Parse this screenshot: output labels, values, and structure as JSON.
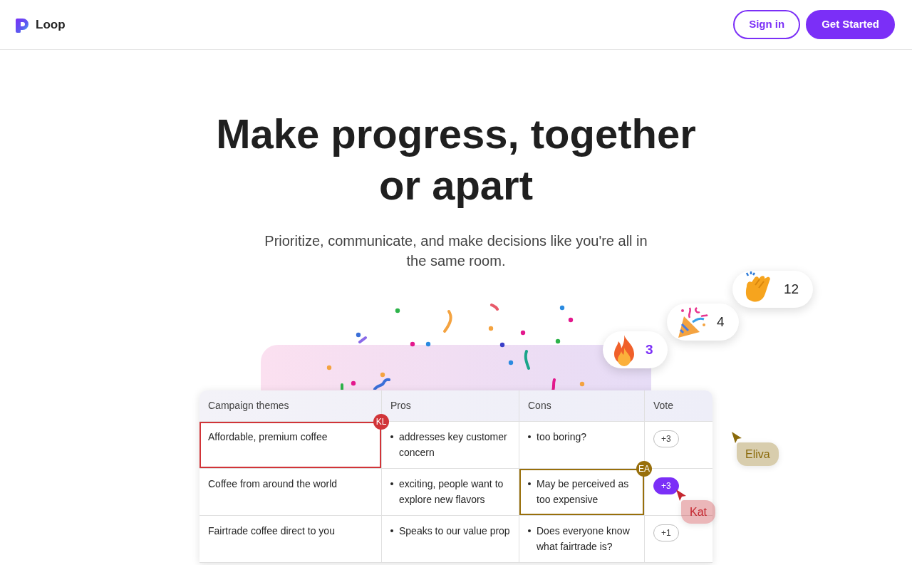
{
  "nav": {
    "brand": "Loop",
    "buttons": [
      {
        "label": "Sign in",
        "kind": "outline"
      },
      {
        "label": "Get Started",
        "kind": "primary"
      }
    ]
  },
  "hero": {
    "title_lines": [
      "Make progress, together",
      "or apart"
    ],
    "subtitle": "Prioritize, communicate, and make decisions like you're all in the same room."
  },
  "reactions": [
    {
      "kind": "fire",
      "count": "3",
      "selected": true
    },
    {
      "kind": "party",
      "count": "4",
      "selected": false
    },
    {
      "kind": "clap",
      "count": "12",
      "selected": false
    }
  ],
  "table": {
    "columns": [
      "Campaign themes",
      "Pros",
      "Cons",
      "Vote"
    ],
    "rows": [
      {
        "theme": {
          "text": "Affordable, premium coffee",
          "editor": {
            "initials": "KL",
            "color": "#d13438"
          }
        },
        "pros": {
          "items": [
            "addresses key customer concern"
          ]
        },
        "cons": {
          "items": [
            "too boring?"
          ]
        },
        "vote": {
          "label": "+3",
          "selected": false
        }
      },
      {
        "theme": {
          "text": "Coffee from around the world"
        },
        "pros": {
          "items": [
            "exciting, people want to explore new flavors"
          ]
        },
        "cons": {
          "items": [
            "May be perceived as too expensive"
          ],
          "editor": {
            "initials": "EA",
            "color": "#986f0b"
          }
        },
        "vote": {
          "label": "+3",
          "selected": true
        }
      },
      {
        "theme": {
          "text": "Fairtrade coffee direct to you"
        },
        "pros": {
          "items": [
            "Speaks to our value prop"
          ]
        },
        "cons": {
          "items": [
            "Does everyone know what fairtrade is?"
          ]
        },
        "vote": {
          "label": "+1",
          "selected": false
        }
      }
    ]
  },
  "cursors": [
    {
      "name": "Eliva",
      "color": "#8a6a0a"
    },
    {
      "name": "Kat",
      "color": "#c4262e"
    }
  ]
}
